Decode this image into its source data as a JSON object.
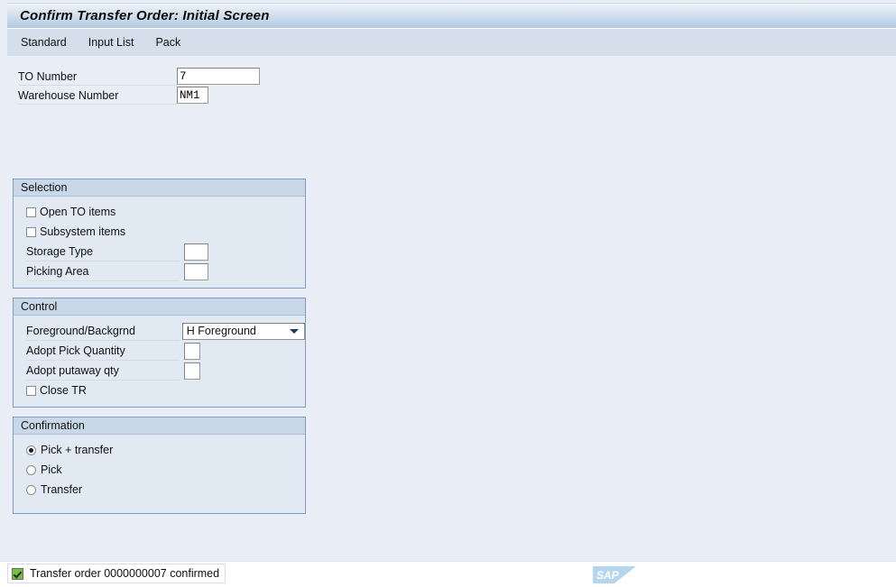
{
  "window": {
    "title": "Confirm Transfer Order: Initial Screen"
  },
  "menubar": {
    "items": [
      {
        "label": "Standard",
        "name": "menu-item-standard"
      },
      {
        "label": "Input List",
        "name": "menu-item-input-list"
      },
      {
        "label": "Pack",
        "name": "menu-item-pack"
      }
    ]
  },
  "form": {
    "to_number": {
      "label": "TO Number",
      "value": "7"
    },
    "warehouse_number": {
      "label": "Warehouse Number",
      "value": "NM1"
    }
  },
  "selection": {
    "title": "Selection",
    "open_to_items": {
      "label": "Open TO items",
      "checked": false
    },
    "subsystem_items": {
      "label": "Subsystem items",
      "checked": false
    },
    "storage_type": {
      "label": "Storage Type",
      "value": ""
    },
    "picking_area": {
      "label": "Picking Area",
      "value": ""
    }
  },
  "control": {
    "title": "Control",
    "foreground_background": {
      "label": "Foreground/Backgrnd",
      "value": "H Foreground",
      "options": [
        "H Foreground"
      ]
    },
    "adopt_pick_quantity": {
      "label": "Adopt Pick Quantity",
      "value": ""
    },
    "adopt_putaway_qty": {
      "label": "Adopt putaway qty",
      "value": ""
    },
    "close_tr": {
      "label": "Close  TR",
      "checked": false
    }
  },
  "confirmation": {
    "title": "Confirmation",
    "options": [
      {
        "label": "Pick + transfer",
        "selected": true
      },
      {
        "label": "Pick",
        "selected": false
      },
      {
        "label": "Transfer",
        "selected": false
      }
    ]
  },
  "statusbar": {
    "icon": "success-check-icon",
    "message": "Transfer order 0000000007 confirmed",
    "logo_text": "SAP"
  },
  "colors": {
    "title_bar_top": "#eef3f9",
    "title_bar_bottom": "#b3c9e0",
    "menu_bar": "#d4dfeb",
    "content_background": "#e9eef6",
    "group_border": "#7e9dc0",
    "group_header": "#c9d8e9",
    "group_body": "#e1e9f3",
    "status_success": "#77c043",
    "sap_logo_blue": "#b5d6ef"
  }
}
